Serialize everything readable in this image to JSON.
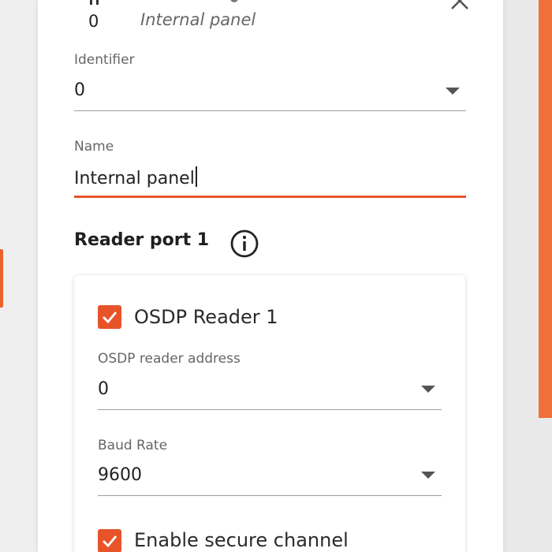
{
  "header": {
    "number": "0",
    "subtitle": "Internal panel"
  },
  "identifier": {
    "label": "Identifier",
    "value": "0"
  },
  "name": {
    "label": "Name",
    "value": "Internal panel"
  },
  "reader_port": {
    "title": "Reader port 1",
    "osdp_checkbox": {
      "label": "OSDP Reader 1",
      "checked": true
    },
    "osdp_address": {
      "label": "OSDP reader address",
      "value": "0"
    },
    "baud_rate": {
      "label": "Baud Rate",
      "value": "9600"
    },
    "secure_channel": {
      "label": "Enable secure channel",
      "checked": true
    }
  },
  "colors": {
    "accent": "#e8542a",
    "right_bar": "#f0703a"
  },
  "icons": [
    "hash-icon",
    "close-icon",
    "chevron-down-icon",
    "info-icon",
    "check-icon"
  ]
}
